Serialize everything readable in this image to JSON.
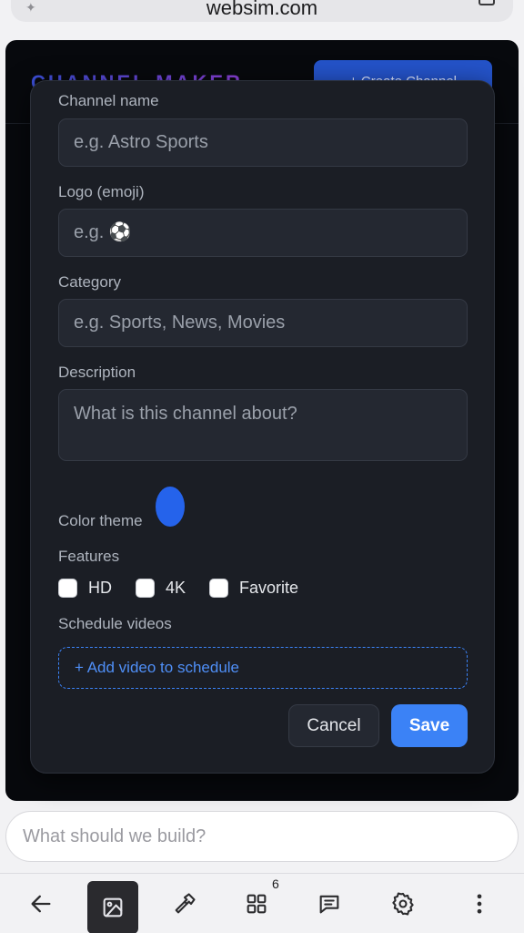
{
  "browser": {
    "url": "websim.com"
  },
  "app": {
    "brand": "CHANNEL MAKER",
    "create_button": "+ Create Channel"
  },
  "modal": {
    "channel_name": {
      "label": "Channel name",
      "placeholder": "e.g. Astro Sports",
      "value": ""
    },
    "logo": {
      "label": "Logo (emoji)",
      "placeholder": "e.g. ⚽",
      "value": ""
    },
    "category": {
      "label": "Category",
      "placeholder": "e.g. Sports, News, Movies",
      "value": ""
    },
    "description": {
      "label": "Description",
      "placeholder": "What is this channel about?",
      "value": ""
    },
    "color_theme": {
      "label": "Color theme",
      "color": "#2563eb"
    },
    "features": {
      "label": "Features",
      "options": [
        {
          "label": "HD",
          "checked": false
        },
        {
          "label": "4K",
          "checked": false
        },
        {
          "label": "Favorite",
          "checked": false
        }
      ]
    },
    "schedule": {
      "label": "Schedule videos",
      "add_label": "+ Add video to schedule"
    },
    "cancel_label": "Cancel",
    "save_label": "Save"
  },
  "prompt": {
    "placeholder": "What should we build?"
  },
  "toolbar": {
    "tabs_count": "6"
  },
  "colors": {
    "accent": "#3b82f6",
    "modal_bg": "#1b1e25",
    "field_bg": "#242831"
  }
}
